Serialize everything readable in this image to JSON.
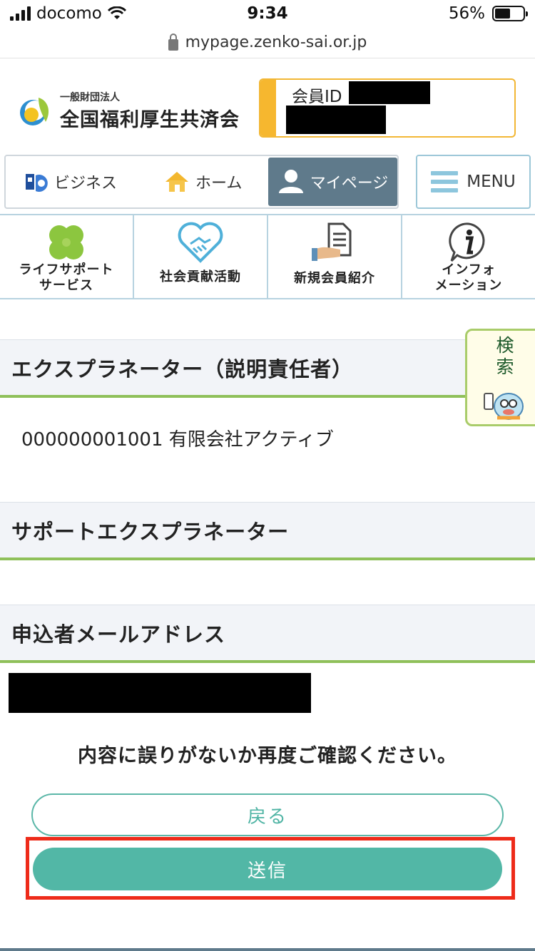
{
  "status_bar": {
    "carrier": "docomo",
    "time": "9:34",
    "battery": "56%"
  },
  "url": "mypage.zenko-sai.or.jp",
  "header": {
    "org_small": "一般財団法人",
    "org_name": "全国福利厚生共済会",
    "member_label": "会員ID"
  },
  "nav": {
    "business": "ビジネス",
    "home": "ホーム",
    "mypage": "マイページ",
    "menu": "MENU"
  },
  "categories": [
    {
      "line1": "ライフサポート",
      "line2": "サービス"
    },
    {
      "line1": "社会貢献活動",
      "line2": ""
    },
    {
      "line1": "新規会員紹介",
      "line2": ""
    },
    {
      "line1": "インフォ",
      "line2": "メーション"
    }
  ],
  "search_tab": {
    "label_line1": "検",
    "label_line2": "索"
  },
  "sections": {
    "explainer_title": "エクスプラネーター（説明責任者）",
    "explainer_value": "000000001001 有限会社アクティブ",
    "support_title": "サポートエクスプラネーター",
    "email_title": "申込者メールアドレス"
  },
  "confirm_message": "内容に誤りがないか再度ご確認ください。",
  "buttons": {
    "back": "戻る",
    "send": "送信"
  },
  "colors": {
    "accent_green": "#8fc05a",
    "teal_button": "#52b7a6",
    "nav_active": "#5f7a8b",
    "highlight_red": "#ee2b1a",
    "member_yellow": "#f6b72f"
  }
}
